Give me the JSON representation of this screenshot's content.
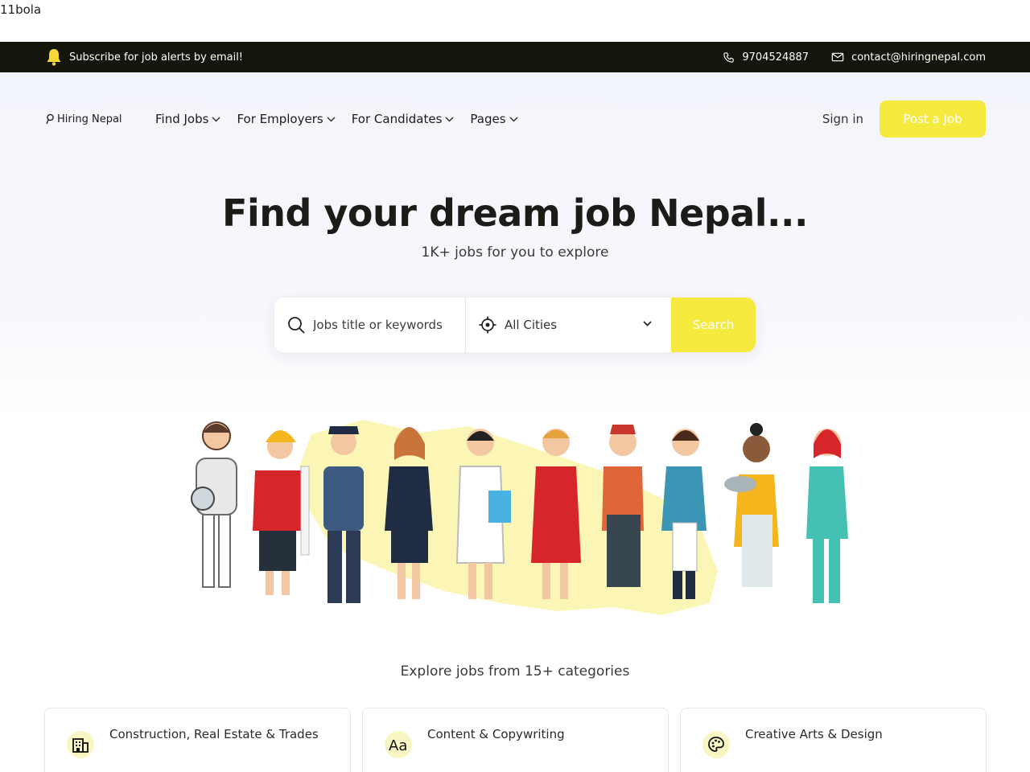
{
  "stray_text": "11bola",
  "topbar": {
    "subscribe_text": "Subscribe for job alerts by email!",
    "phone": "9704524887",
    "email": "contact@hiringnepal.com"
  },
  "nav": {
    "logo_text": "Hiring Nepal",
    "menu": [
      {
        "label": "Find Jobs"
      },
      {
        "label": "For Employers"
      },
      {
        "label": "For Candidates"
      },
      {
        "label": "Pages"
      }
    ],
    "signin_label": "Sign in",
    "post_job_label": "Post a Job"
  },
  "hero": {
    "headline": "Find your dream job Nepal...",
    "subhead": "1K+ jobs for you to explore"
  },
  "search": {
    "keyword_placeholder": "Jobs title or keywords",
    "city_value": "All Cities",
    "button_label": "Search"
  },
  "categories": {
    "title": "Explore jobs from 15+ categories",
    "items": [
      {
        "label": "Construction, Real Estate & Trades",
        "icon": "building-icon"
      },
      {
        "label": "Content & Copywriting",
        "icon": "font-icon"
      },
      {
        "label": "Creative Arts & Design",
        "icon": "palette-icon"
      }
    ]
  },
  "colors": {
    "accent": "#f6ea3f",
    "topbar_bg": "#14150b",
    "icon_blob": "#f9f6c4"
  }
}
